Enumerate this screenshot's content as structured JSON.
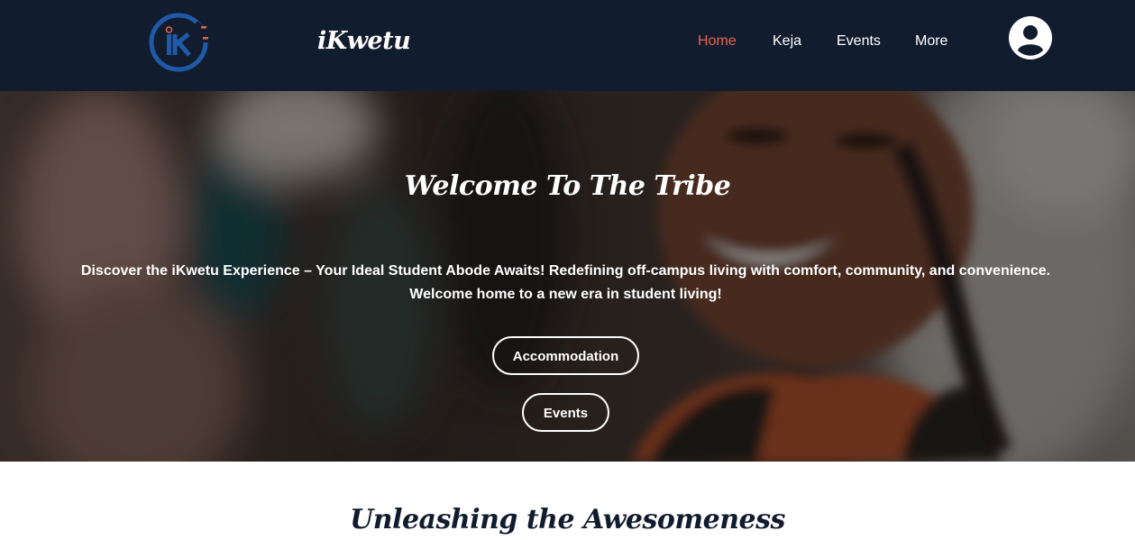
{
  "header": {
    "brand": "iKwetu",
    "logo_icon": "ikwetu-logo-icon",
    "nav": {
      "home": "Home",
      "keja": "Keja",
      "events": "Events",
      "more": "More"
    },
    "active_nav": "Home",
    "account_icon": "user-account-icon"
  },
  "hero": {
    "title": "Welcome To The Tribe",
    "description": "Discover the iKwetu Experience – Your Ideal Student Abode Awaits! Redefining off-campus living with comfort, community, and convenience. Welcome home to a new era in student living!",
    "buttons": {
      "accommodation": "Accommodation",
      "events": "Events"
    }
  },
  "section": {
    "heading": "Unleashing the Awesomeness"
  },
  "colors": {
    "navbar_bg": "#121c2f",
    "accent": "#e8624a",
    "logo_blue": "#1e5aa8",
    "heading_navy": "#121c2f"
  }
}
